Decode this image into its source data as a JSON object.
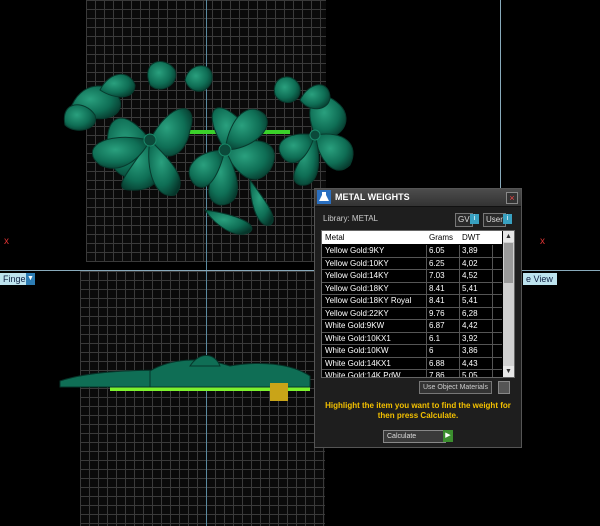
{
  "viewports": {
    "bottom_left_label": "Finger",
    "bottom_right_label": "e View",
    "axis_x": "x"
  },
  "dialog": {
    "title": "METAL WEIGHTS",
    "library_label": "Library: METAL",
    "gv_label": "GV",
    "user_label": "User",
    "close": "×",
    "table": {
      "headers": [
        "Metal",
        "Grams",
        "DWT"
      ],
      "rows": [
        {
          "metal": "Yellow Gold:9KY",
          "grams": "6.05",
          "dwt": "3,89"
        },
        {
          "metal": "Yellow Gold:10KY",
          "grams": "6.25",
          "dwt": "4,02"
        },
        {
          "metal": "Yellow Gold:14KY",
          "grams": "7.03",
          "dwt": "4,52"
        },
        {
          "metal": "Yellow Gold:18KY",
          "grams": "8.41",
          "dwt": "5,41"
        },
        {
          "metal": "Yellow Gold:18KY Royal",
          "grams": "8.41",
          "dwt": "5,41"
        },
        {
          "metal": "Yellow Gold:22KY",
          "grams": "9.76",
          "dwt": "6,28"
        },
        {
          "metal": "White Gold:9KW",
          "grams": "6.87",
          "dwt": "4,42"
        },
        {
          "metal": "White Gold:10KX1",
          "grams": "6.1",
          "dwt": "3,92"
        },
        {
          "metal": "White Gold:10KW",
          "grams": "6",
          "dwt": "3,86"
        },
        {
          "metal": "White Gold:14KX1",
          "grams": "6.88",
          "dwt": "4,43"
        },
        {
          "metal": "White Gold:14K PdW",
          "grams": "7.86",
          "dwt": "5,05"
        }
      ]
    },
    "use_object_materials": "Use Object Materials",
    "hint": "Highlight the item you want to find the weight for then press Calculate.",
    "calculate_label": "Calculate"
  },
  "colors": {
    "model_green": "#0f6e55",
    "highlight_yellow": "#f3c000",
    "accent_blue": "#38a0c0"
  }
}
